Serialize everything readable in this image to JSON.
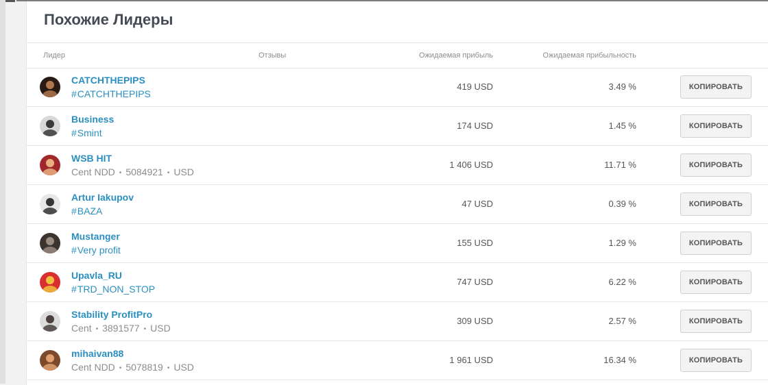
{
  "page": {
    "title": "Похожие Лидеры"
  },
  "table": {
    "columns": {
      "leader": "Лидер",
      "reviews": "Отзывы",
      "expected_profit": "Ожидаемая прибыль",
      "expected_profitability": "Ожидаемая прибыльность"
    },
    "copy_label": "КОПИРОВАТЬ",
    "rows": [
      {
        "name": "CATCHTHEPIPS",
        "sub_type": "hashtag",
        "hashtag": "CATCHTHEPIPS",
        "profit": "419 USD",
        "profitability": "3.49 %",
        "avatar": {
          "icon": "avatar-dark-photo",
          "bg": "#2a1a14",
          "fg": "#b07850"
        }
      },
      {
        "name": "Business",
        "sub_type": "hashtag",
        "hashtag": "Smint",
        "profit": "174 USD",
        "profitability": "1.45 %",
        "avatar": {
          "icon": "avatar-suit-photo",
          "bg": "#d8d8d8",
          "fg": "#3a3a3a"
        }
      },
      {
        "name": "WSB HIT",
        "sub_type": "account",
        "account": {
          "type": "Cent NDD",
          "number": "5084921",
          "currency": "USD"
        },
        "profit": "1 406 USD",
        "profitability": "11.71 %",
        "avatar": {
          "icon": "avatar-red-photo",
          "bg": "#a0282a",
          "fg": "#e8b080"
        }
      },
      {
        "name": "Artur Iakupov",
        "sub_type": "hashtag",
        "hashtag": "BAZA",
        "profit": "47 USD",
        "profitability": "0.39 %",
        "avatar": {
          "icon": "avatar-bw-photo",
          "bg": "#e6e6e6",
          "fg": "#333333"
        }
      },
      {
        "name": "Mustanger",
        "sub_type": "hashtag",
        "hashtag": "Very profit",
        "profit": "155 USD",
        "profitability": "1.29 %",
        "avatar": {
          "icon": "avatar-dark-photo",
          "bg": "#3a3330",
          "fg": "#9a8a80"
        }
      },
      {
        "name": "Upavla_RU",
        "sub_type": "hashtag",
        "hashtag": "TRD_NON_STOP",
        "profit": "747 USD",
        "profitability": "6.22 %",
        "avatar": {
          "icon": "avatar-colorful-photo",
          "bg": "#d83030",
          "fg": "#f0c040"
        }
      },
      {
        "name": "Stability ProfitPro",
        "sub_type": "account",
        "account": {
          "type": "Cent",
          "number": "3891577",
          "currency": "USD"
        },
        "profit": "309 USD",
        "profitability": "2.57 %",
        "avatar": {
          "icon": "avatar-light-photo",
          "bg": "#dcdcdc",
          "fg": "#4a4040"
        }
      },
      {
        "name": "mihaivan88",
        "sub_type": "account",
        "account": {
          "type": "Cent NDD",
          "number": "5078819",
          "currency": "USD"
        },
        "profit": "1 961 USD",
        "profitability": "16.34 %",
        "avatar": {
          "icon": "avatar-warm-photo",
          "bg": "#7a4a2a",
          "fg": "#e0a070"
        }
      }
    ]
  }
}
